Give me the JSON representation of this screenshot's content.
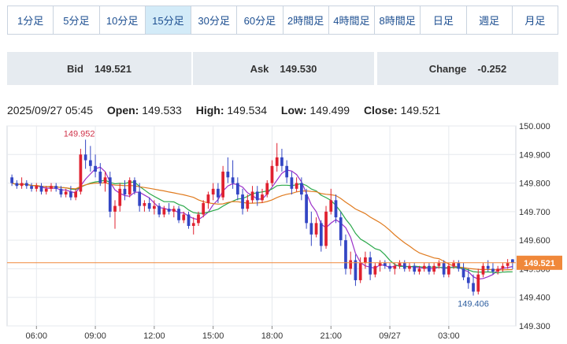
{
  "timeframe_tabs": [
    {
      "label": "1分足",
      "active": false
    },
    {
      "label": "5分足",
      "active": false
    },
    {
      "label": "10分足",
      "active": false
    },
    {
      "label": "15分足",
      "active": true
    },
    {
      "label": "30分足",
      "active": false
    },
    {
      "label": "60分足",
      "active": false
    },
    {
      "label": "2時間足",
      "active": false
    },
    {
      "label": "4時間足",
      "active": false
    },
    {
      "label": "8時間足",
      "active": false
    },
    {
      "label": "日足",
      "active": false
    },
    {
      "label": "週足",
      "active": false
    },
    {
      "label": "月足",
      "active": false
    }
  ],
  "quote": {
    "bid_label": "Bid",
    "bid_value": "149.521",
    "ask_label": "Ask",
    "ask_value": "149.530",
    "change_label": "Change",
    "change_value": "-0.252"
  },
  "ohlc": {
    "timestamp": "2025/09/27 05:45",
    "open_label": "Open:",
    "open": "149.533",
    "high_label": "High:",
    "high": "149.534",
    "low_label": "Low:",
    "low": "149.499",
    "close_label": "Close:",
    "close": "149.521"
  },
  "colors": {
    "up": "#e0212f",
    "down": "#3346c4",
    "ma_short": "#9b2fc9",
    "ma_mid": "#2aa84a",
    "ma_long": "#e07b1f",
    "price_line": "#f0883a"
  },
  "chart_data": {
    "type": "candlestick",
    "ylim": [
      149.3,
      150.0
    ],
    "y_ticks": [
      "150.000",
      "149.900",
      "149.800",
      "149.700",
      "149.600",
      "149.500",
      "149.400",
      "149.300"
    ],
    "x_ticks": [
      "06:00",
      "09:00",
      "12:00",
      "15:00",
      "18:00",
      "21:00",
      "09/27",
      "03:00"
    ],
    "x_tick_index": [
      5,
      17,
      29,
      41,
      53,
      65,
      77,
      89
    ],
    "current_price": "149.521",
    "high_annotation": {
      "label": "149.952",
      "index": 15,
      "value": 149.952
    },
    "low_annotation": {
      "label": "149.406",
      "index": 94,
      "value": 149.406
    },
    "candles": [
      [
        149.82,
        149.83,
        149.79,
        149.8
      ],
      [
        149.8,
        149.81,
        149.78,
        149.79
      ],
      [
        149.79,
        149.82,
        149.78,
        149.8
      ],
      [
        149.8,
        149.81,
        149.78,
        149.79
      ],
      [
        149.79,
        149.8,
        149.77,
        149.78
      ],
      [
        149.78,
        149.8,
        149.77,
        149.79
      ],
      [
        149.79,
        149.8,
        149.76,
        149.77
      ],
      [
        149.77,
        149.79,
        149.76,
        149.78
      ],
      [
        149.78,
        149.8,
        149.77,
        149.79
      ],
      [
        149.79,
        149.8,
        149.77,
        149.78
      ],
      [
        149.78,
        149.79,
        149.75,
        149.76
      ],
      [
        149.76,
        149.78,
        149.75,
        149.77
      ],
      [
        149.77,
        149.79,
        149.74,
        149.75
      ],
      [
        149.75,
        149.78,
        149.74,
        149.77
      ],
      [
        149.77,
        149.92,
        149.76,
        149.9
      ],
      [
        149.9,
        149.952,
        149.85,
        149.88
      ],
      [
        149.88,
        149.93,
        149.84,
        149.86
      ],
      [
        149.86,
        149.9,
        149.82,
        149.84
      ],
      [
        149.84,
        149.87,
        149.79,
        149.8
      ],
      [
        149.8,
        149.84,
        149.77,
        149.82
      ],
      [
        149.82,
        149.84,
        149.68,
        149.7
      ],
      [
        149.7,
        149.74,
        149.64,
        149.72
      ],
      [
        149.72,
        149.8,
        149.7,
        149.78
      ],
      [
        149.78,
        149.81,
        149.74,
        149.76
      ],
      [
        149.76,
        149.82,
        149.75,
        149.81
      ],
      [
        149.81,
        149.82,
        149.76,
        149.77
      ],
      [
        149.77,
        149.8,
        149.7,
        149.72
      ],
      [
        149.72,
        149.74,
        149.7,
        149.73
      ],
      [
        149.73,
        149.75,
        149.7,
        149.71
      ],
      [
        149.71,
        149.74,
        149.69,
        149.72
      ],
      [
        149.72,
        149.73,
        149.68,
        149.69
      ],
      [
        149.69,
        149.72,
        149.68,
        149.71
      ],
      [
        149.71,
        149.73,
        149.69,
        149.7
      ],
      [
        149.7,
        149.72,
        149.68,
        149.71
      ],
      [
        149.71,
        149.72,
        149.66,
        149.67
      ],
      [
        149.67,
        149.7,
        149.66,
        149.69
      ],
      [
        149.69,
        149.7,
        149.64,
        149.65
      ],
      [
        149.65,
        149.68,
        149.62,
        149.66
      ],
      [
        149.66,
        149.7,
        149.65,
        149.69
      ],
      [
        149.69,
        149.74,
        149.68,
        149.73
      ],
      [
        149.73,
        149.77,
        149.71,
        149.76
      ],
      [
        149.76,
        149.8,
        149.74,
        149.78
      ],
      [
        149.78,
        149.8,
        149.73,
        149.75
      ],
      [
        149.75,
        149.86,
        149.74,
        149.84
      ],
      [
        149.84,
        149.89,
        149.8,
        149.82
      ],
      [
        149.82,
        149.88,
        149.78,
        149.8
      ],
      [
        149.8,
        149.82,
        149.74,
        149.76
      ],
      [
        149.76,
        149.78,
        149.69,
        149.71
      ],
      [
        149.71,
        149.76,
        149.7,
        149.74
      ],
      [
        149.74,
        149.79,
        149.73,
        149.77
      ],
      [
        149.77,
        149.79,
        149.72,
        149.74
      ],
      [
        149.74,
        149.78,
        149.73,
        149.76
      ],
      [
        149.76,
        149.81,
        149.75,
        149.8
      ],
      [
        149.8,
        149.88,
        149.79,
        149.86
      ],
      [
        149.86,
        149.94,
        149.84,
        149.89
      ],
      [
        149.89,
        149.92,
        149.84,
        149.86
      ],
      [
        149.86,
        149.88,
        149.8,
        149.82
      ],
      [
        149.82,
        149.84,
        149.76,
        149.78
      ],
      [
        149.78,
        149.82,
        149.77,
        149.8
      ],
      [
        149.8,
        149.82,
        149.74,
        149.76
      ],
      [
        149.76,
        149.78,
        149.64,
        149.66
      ],
      [
        149.66,
        149.7,
        149.58,
        149.62
      ],
      [
        149.62,
        149.68,
        149.61,
        149.66
      ],
      [
        149.66,
        149.67,
        149.56,
        149.58
      ],
      [
        149.58,
        149.72,
        149.57,
        149.7
      ],
      [
        149.7,
        149.78,
        149.69,
        149.74
      ],
      [
        149.74,
        149.76,
        149.66,
        149.68
      ],
      [
        149.68,
        149.7,
        149.58,
        149.6
      ],
      [
        149.6,
        149.62,
        149.48,
        149.5
      ],
      [
        149.5,
        149.56,
        149.48,
        149.53
      ],
      [
        149.53,
        149.55,
        149.44,
        149.46
      ],
      [
        149.46,
        149.54,
        149.45,
        149.52
      ],
      [
        149.52,
        149.56,
        149.5,
        149.54
      ],
      [
        149.54,
        149.56,
        149.46,
        149.48
      ],
      [
        149.48,
        149.52,
        149.47,
        149.51
      ],
      [
        149.51,
        149.53,
        149.49,
        149.52
      ],
      [
        149.52,
        149.53,
        149.5,
        149.51
      ],
      [
        149.51,
        149.52,
        149.49,
        149.5
      ],
      [
        149.5,
        149.52,
        149.48,
        149.51
      ],
      [
        149.51,
        149.53,
        149.5,
        149.52
      ],
      [
        149.52,
        149.53,
        149.49,
        149.5
      ],
      [
        149.5,
        149.52,
        149.49,
        149.51
      ],
      [
        149.51,
        149.52,
        149.48,
        149.49
      ],
      [
        149.49,
        149.51,
        149.48,
        149.5
      ],
      [
        149.5,
        149.52,
        149.49,
        149.51
      ],
      [
        149.51,
        149.52,
        149.48,
        149.49
      ],
      [
        149.49,
        149.52,
        149.48,
        149.51
      ],
      [
        149.51,
        149.53,
        149.5,
        149.52
      ],
      [
        149.52,
        149.53,
        149.47,
        149.48
      ],
      [
        149.48,
        149.52,
        149.47,
        149.51
      ],
      [
        149.51,
        149.53,
        149.5,
        149.52
      ],
      [
        149.52,
        149.53,
        149.49,
        149.5
      ],
      [
        149.5,
        149.52,
        149.46,
        149.47
      ],
      [
        149.47,
        149.5,
        149.43,
        149.45
      ],
      [
        149.45,
        149.48,
        149.406,
        149.42
      ],
      [
        149.42,
        149.5,
        149.41,
        149.48
      ],
      [
        149.48,
        149.52,
        149.47,
        149.51
      ],
      [
        149.51,
        149.53,
        149.49,
        149.5
      ],
      [
        149.5,
        149.52,
        149.48,
        149.49
      ],
      [
        149.49,
        149.51,
        149.48,
        149.5
      ],
      [
        149.5,
        149.52,
        149.49,
        149.51
      ],
      [
        149.51,
        149.534,
        149.5,
        149.52
      ],
      [
        149.533,
        149.534,
        149.499,
        149.521
      ]
    ]
  }
}
